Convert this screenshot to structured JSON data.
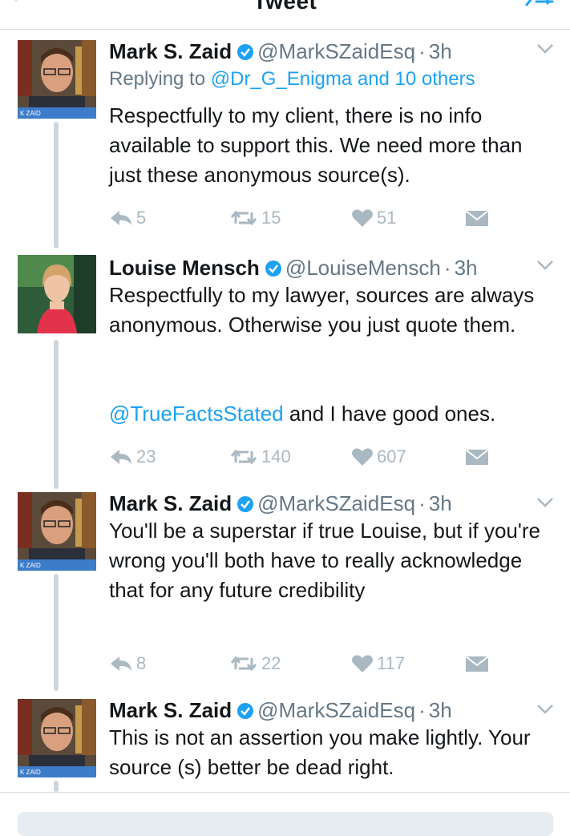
{
  "nav": {
    "title": "Tweet"
  },
  "tweets": [
    {
      "name": "Mark S. Zaid",
      "handle": "@MarkSZaidEsq",
      "dot": "·",
      "time": "3h",
      "reply_prefix": "Replying to",
      "reply_targets": "@Dr_G_Enigma and 10 others",
      "text": "Respectfully to my client, there is no info available to support this. We need more than just these anonymous source(s).",
      "replies": "5",
      "retweets": "15",
      "likes": "51",
      "avatar_caption": "K ZAID"
    },
    {
      "name": "Louise Mensch",
      "handle": "@LouiseMensch",
      "dot": "·",
      "time": "3h",
      "text": "Respectfully to my lawyer, sources are always anonymous. Otherwise you just quote them.",
      "mention": "@TrueFactsStated",
      "text_tail": " and I have good ones.",
      "replies": "23",
      "retweets": "140",
      "likes": "607"
    },
    {
      "name": "Mark S. Zaid",
      "handle": "@MarkSZaidEsq",
      "dot": "·",
      "time": "3h",
      "text": "You'll be a superstar if true Louise, but if you're wrong you'll both have to really acknowledge that for any future credibility",
      "replies": "8",
      "retweets": "22",
      "likes": "117",
      "avatar_caption": "K ZAID"
    },
    {
      "name": "Mark S. Zaid",
      "handle": "@MarkSZaidEsq",
      "dot": "·",
      "time": "3h",
      "text": "This is not an assertion you make lightly. Your source (s) better be dead right.",
      "avatar_caption": "K ZAID"
    }
  ],
  "colors": {
    "link": "#1da1f2",
    "muted": "#657786",
    "icon": "#aab8c2",
    "verified": "#1da1f2"
  }
}
